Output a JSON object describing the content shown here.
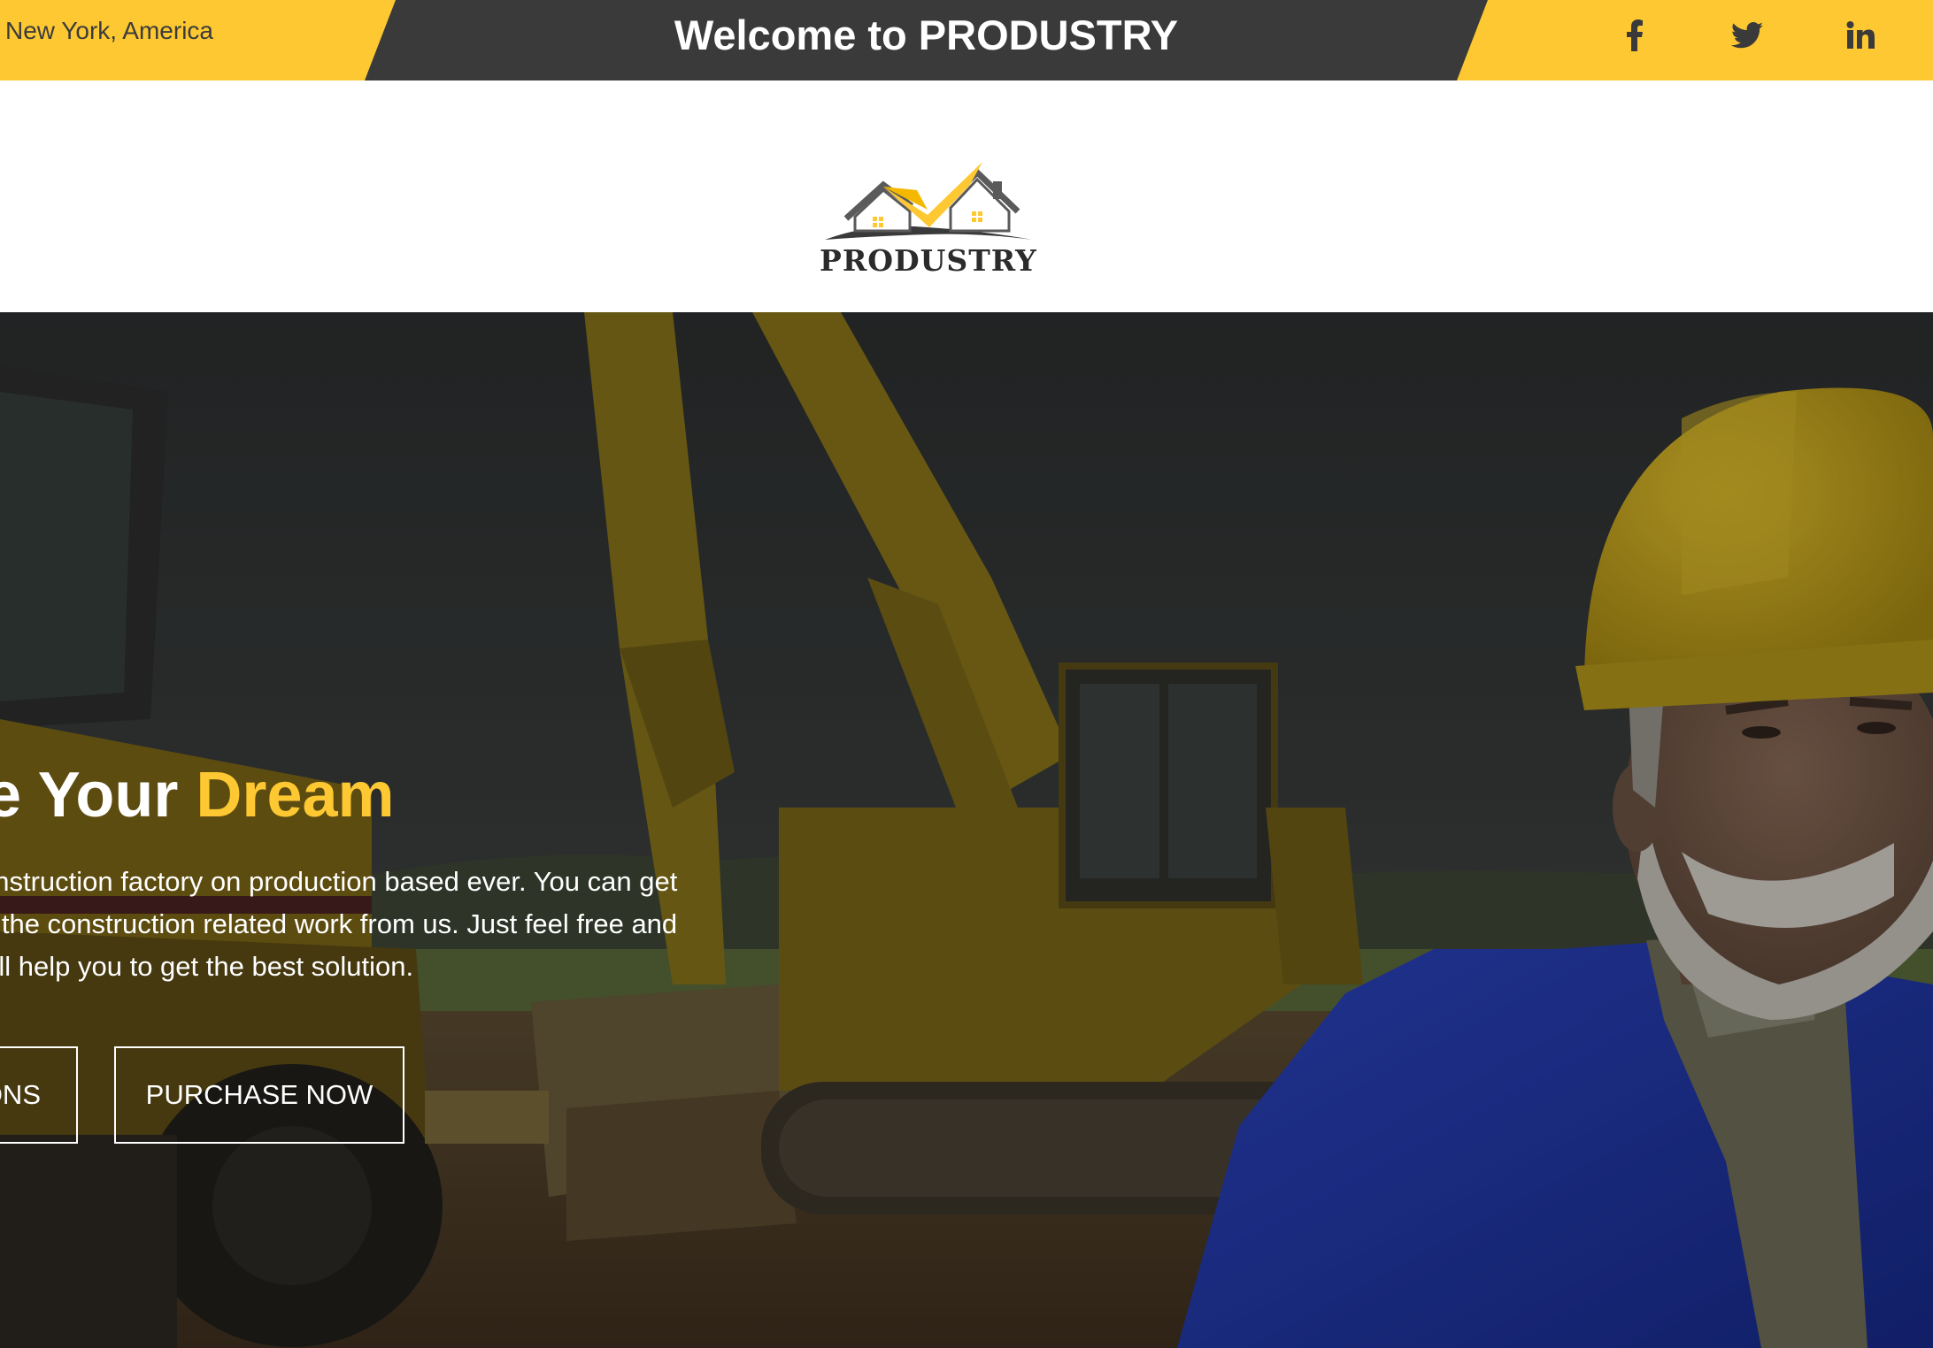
{
  "topbar": {
    "location": "New York, America",
    "welcome": "Welcome to PRODUSTRY",
    "social": {
      "facebook": "facebook-icon",
      "twitter": "twitter-icon",
      "linkedin": "linkedin-icon"
    }
  },
  "header": {
    "logo_text": "PRODUSTRY"
  },
  "hero": {
    "title_white": "e Your ",
    "title_accent": "Dream",
    "text_lines": [
      "onstruction factory on production based ever. You can get",
      "n the construction related work from us. Just feel free and",
      "vill help you to get the best solution."
    ],
    "btn_services": "ONS",
    "btn_purchase": "PURCHASE NOW"
  },
  "colors": {
    "accent": "#fec832",
    "topbar_dark": "#3a3a3a",
    "helmet_blue_jacket": "#1e37b8"
  }
}
